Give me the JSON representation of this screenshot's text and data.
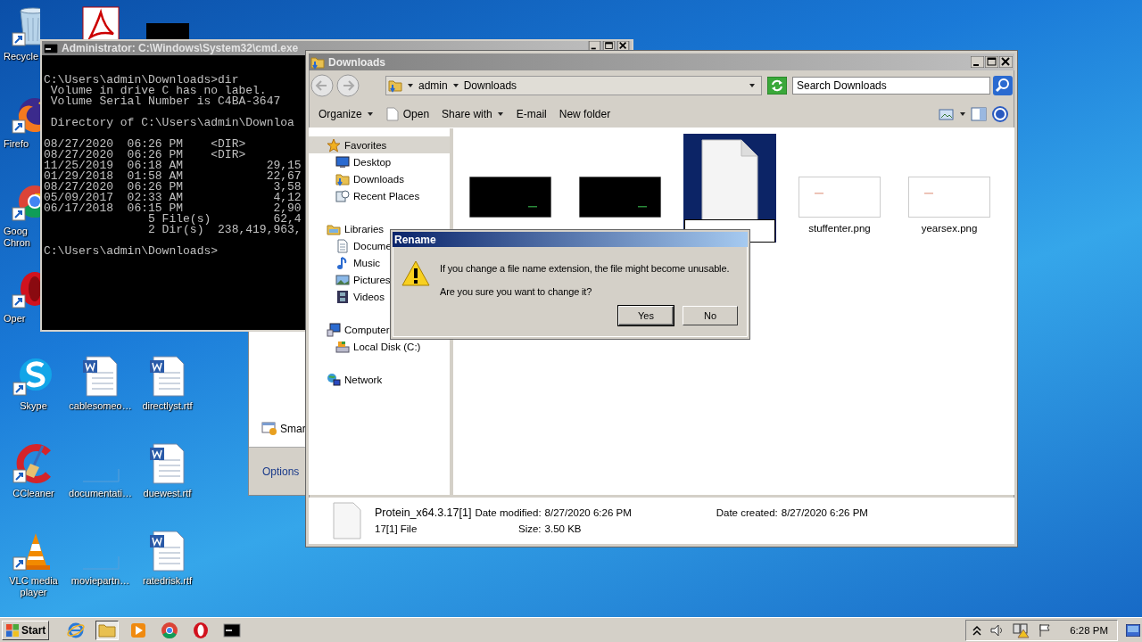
{
  "desktop_columns": [
    {
      "icons": [
        {
          "kind": "recycle",
          "label": "Recycle",
          "cut": true
        },
        {
          "kind": "firefox",
          "label": "Firefo",
          "cut": true
        },
        {
          "kind": "chrome",
          "label": "Goog Chron",
          "cut": true
        },
        {
          "kind": "opera",
          "label": "Oper",
          "cut": true
        },
        {
          "kind": "skype",
          "label": "Skype",
          "cut": false
        },
        {
          "kind": "ccleaner",
          "label": "CCleaner",
          "cut": false
        },
        {
          "kind": "vlc",
          "label": "VLC media player",
          "cut": false
        }
      ]
    },
    {
      "icons": [
        {
          "kind": "pdf"
        },
        {
          "kind": "word",
          "label": "cablesomeo…",
          "cut": false
        },
        {
          "kind": "blank",
          "label": "documentati…",
          "cut": false
        },
        {
          "kind": "blank",
          "label": "moviepartn…",
          "cut": false
        }
      ]
    },
    {
      "icons": [
        {
          "kind": "dark"
        },
        {
          "kind": "word",
          "label": "directlyst.rtf",
          "cut": false
        },
        {
          "kind": "word",
          "label": "duewest.rtf",
          "cut": false
        },
        {
          "kind": "word",
          "label": "ratedrisk.rtf",
          "cut": false
        }
      ]
    }
  ],
  "background_window": {
    "items": [
      {
        "label": "Smar"
      }
    ],
    "footer": "Options"
  },
  "console": {
    "title": "Administrator: C:\\Windows\\System32\\cmd.exe",
    "blocks": [
      [
        "C:\\Users\\admin\\Downloads>dir",
        " Volume in drive C has no label.",
        " Volume Serial Number is C4BA-3647"
      ],
      [
        " Directory of C:\\Users\\admin\\Downloa"
      ],
      [
        "08/27/2020  06:26 PM    <DIR>",
        "08/27/2020  06:26 PM    <DIR>",
        "11/25/2019  06:18 AM            29,15",
        "01/29/2018  01:58 AM            22,67",
        "08/27/2020  06:26 PM             3,58",
        "05/09/2017  02:33 AM             4,12",
        "06/17/2018  06:15 PM             2,90",
        "               5 File(s)         62,4",
        "               2 Dir(s)  238,419,963,"
      ],
      [
        "C:\\Users\\admin\\Downloads>"
      ]
    ]
  },
  "explorer": {
    "title": "Downloads",
    "breadcrumb": [
      "admin",
      "Downloads"
    ],
    "search": {
      "placeholder": "Search Downloads"
    },
    "toolbar": [
      {
        "label": "Organize",
        "dropdown": true,
        "kind": "text"
      },
      {
        "label": "Open",
        "dropdown": false,
        "kind": "open"
      },
      {
        "label": "Share with",
        "dropdown": true,
        "kind": "text"
      },
      {
        "label": "E-mail",
        "dropdown": false,
        "kind": "text"
      },
      {
        "label": "New folder",
        "dropdown": false,
        "kind": "text"
      }
    ],
    "navigation": [
      {
        "label": "Favorites",
        "kind": "star",
        "selected": true,
        "children": [
          {
            "label": "Desktop",
            "kind": "desktop",
            "selected": false
          },
          {
            "label": "Downloads",
            "kind": "downloads",
            "selected": false
          },
          {
            "label": "Recent Places",
            "kind": "recent",
            "selected": false
          }
        ]
      },
      {
        "label": "Libraries",
        "kind": "libraries",
        "selected": false,
        "children": [
          {
            "label": "Docume",
            "kind": "documents",
            "selected": false
          },
          {
            "label": "Music",
            "kind": "music",
            "selected": false
          },
          {
            "label": "Pictures",
            "kind": "pictures",
            "selected": false
          },
          {
            "label": "Videos",
            "kind": "videos",
            "selected": false
          }
        ]
      },
      {
        "label": "Computer",
        "kind": "computer",
        "selected": false,
        "children": [
          {
            "label": "Local Disk (C:)",
            "kind": "disk",
            "selected": false
          }
        ]
      },
      {
        "label": "Network",
        "kind": "network",
        "selected": false
      }
    ],
    "files": [
      {
        "kind": "dark",
        "selected": false
      },
      {
        "kind": "dark",
        "selected": false
      },
      {
        "kind": "document",
        "selected": true
      },
      {
        "kind": "light",
        "label": "stuffenter.png",
        "selected": false
      },
      {
        "kind": "light",
        "label": "yearsex.png",
        "selected": false
      }
    ],
    "details": {
      "name": "Protein_x64.3.17[1]",
      "type": "17[1] File",
      "fields": [
        {
          "label": "Date modified:",
          "value": "8/27/2020 6:26 PM"
        },
        {
          "label": "Size:",
          "value": "3.50 KB"
        },
        {
          "label": "Date created:",
          "value": "8/27/2020 6:26 PM"
        }
      ]
    }
  },
  "dialog": {
    "title": "Rename",
    "message": "If you change a file name extension, the file might become unusable.",
    "question": "Are you sure you want to change it?",
    "buttons": [
      {
        "label": "Yes",
        "default": true
      },
      {
        "label": "No",
        "default": false
      }
    ]
  },
  "taskbar": {
    "start": "Start",
    "buttons": [
      {
        "kind": "ie",
        "selected": false
      },
      {
        "kind": "folder",
        "selected": true
      },
      {
        "kind": "media",
        "selected": false
      },
      {
        "kind": "chrome",
        "selected": false
      },
      {
        "kind": "opera",
        "selected": false
      },
      {
        "kind": "cmd",
        "selected": false
      }
    ],
    "clock": "6:28 PM"
  }
}
